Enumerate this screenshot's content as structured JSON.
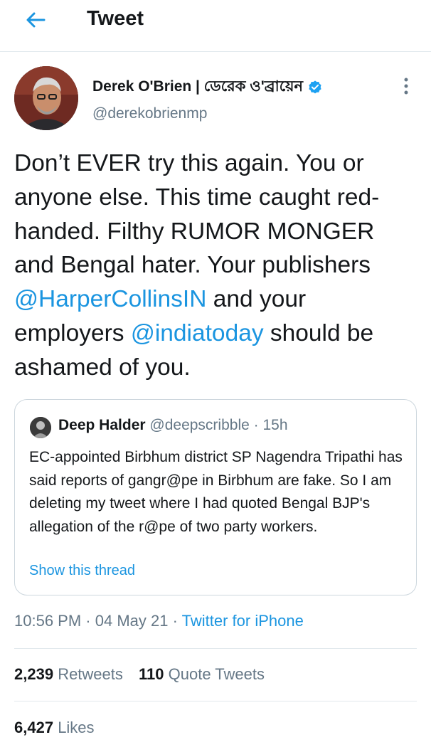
{
  "header": {
    "title": "Tweet"
  },
  "tweet": {
    "name": "Derek O'Brien | ডেরেক ও'ব্রায়েন",
    "handle": "@derekobrienmp",
    "text_parts": {
      "p1": "Don’t EVER try this again. You or anyone else. This time caught red-handed. Filthy RUMOR MONGER and Bengal hater. Your publishers ",
      "mention1": "@HarperCollinsIN",
      "p2": " and your employers ",
      "mention2": "@indiatoday",
      "p3": " should be ashamed of you."
    },
    "quoted": {
      "name": "Deep Halder",
      "handle": "@deepscribble",
      "time": "15h",
      "text": "EC-appointed Birbhum district SP Nagendra Tripathi has said reports of gangr@pe in Birbhum are fake. So I am deleting my tweet where I had quoted Bengal BJP's allegation of the r@pe of two party workers.",
      "show_thread": "Show this thread"
    },
    "time": "10:56 PM",
    "date": "04 May 21",
    "source": "Twitter for iPhone",
    "retweets_count": "2,239",
    "retweets_label": "Retweets",
    "quotes_count": "110",
    "quotes_label": "Quote Tweets",
    "likes_count": "6,427",
    "likes_label": "Likes"
  },
  "colors": {
    "accent": "#1b95e0",
    "secondary": "#657786",
    "divider": "#e1e8ed"
  },
  "icons": {
    "back": "arrow-left-icon",
    "verified": "verified-badge-icon",
    "more": "more-vertical-icon"
  }
}
